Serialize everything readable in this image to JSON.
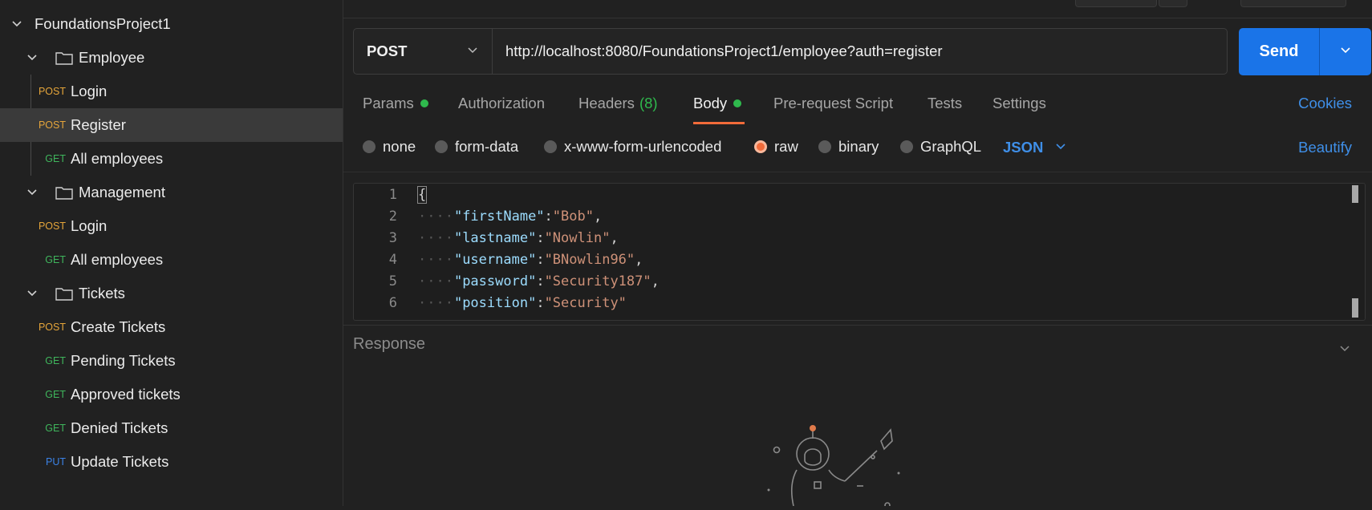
{
  "sidebar": {
    "collection": "FoundationsProject1",
    "folders": [
      {
        "name": "Employee",
        "requests": [
          {
            "method": "POST",
            "name": "Login"
          },
          {
            "method": "POST",
            "name": "Register",
            "selected": true
          },
          {
            "method": "GET",
            "name": "All employees"
          }
        ]
      },
      {
        "name": "Management",
        "requests": [
          {
            "method": "POST",
            "name": "Login"
          },
          {
            "method": "GET",
            "name": "All employees"
          }
        ]
      },
      {
        "name": "Tickets",
        "requests": [
          {
            "method": "POST",
            "name": "Create Tickets"
          },
          {
            "method": "GET",
            "name": "Pending Tickets"
          },
          {
            "method": "GET",
            "name": "Approved tickets"
          },
          {
            "method": "GET",
            "name": "Denied Tickets"
          },
          {
            "method": "PUT",
            "name": "Update Tickets"
          }
        ]
      }
    ]
  },
  "request": {
    "method": "POST",
    "url": "http://localhost:8080/FoundationsProject1/employee?auth=register",
    "send_label": "Send"
  },
  "tabs": {
    "params": "Params",
    "authorization": "Authorization",
    "headers": "Headers",
    "headers_count": "(8)",
    "body": "Body",
    "prerequest": "Pre-request Script",
    "tests": "Tests",
    "settings": "Settings",
    "cookies": "Cookies",
    "active": "Body"
  },
  "body_options": {
    "none": "none",
    "form_data": "form-data",
    "urlencoded": "x-www-form-urlencoded",
    "raw": "raw",
    "binary": "binary",
    "graphql": "GraphQL",
    "selected": "raw",
    "format": "JSON",
    "beautify": "Beautify"
  },
  "editor": {
    "line_numbers": [
      "1",
      "2",
      "3",
      "4",
      "5",
      "6"
    ],
    "open_brace": "{",
    "fields": [
      {
        "key": "\"firstName\"",
        "value": "\"Bob\"",
        "comma": ","
      },
      {
        "key": "\"lastname\"",
        "value": "\"Nowlin\"",
        "comma": ","
      },
      {
        "key": "\"username\"",
        "value": "\"BNowlin96\"",
        "comma": ","
      },
      {
        "key": "\"password\"",
        "value": "\"Security187\"",
        "comma": ","
      },
      {
        "key": "\"position\"",
        "value": "\"Security\"",
        "comma": ""
      }
    ]
  },
  "response": {
    "label": "Response"
  },
  "colors": {
    "accent": "#1a74e8",
    "active_tab": "#f26b3a",
    "post": "#e5a53a",
    "get": "#3fb55c",
    "put": "#3b82e6"
  }
}
